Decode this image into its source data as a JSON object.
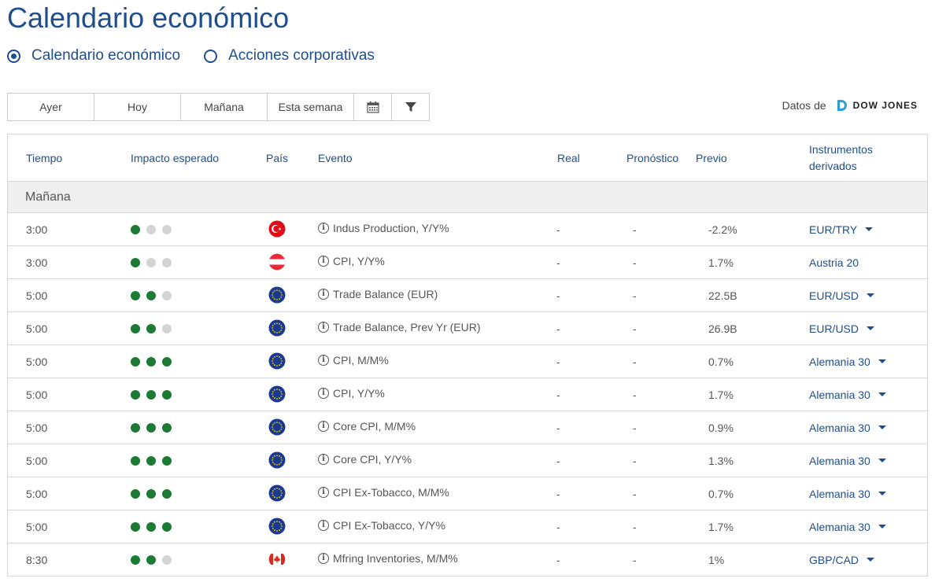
{
  "page": {
    "title": "Calendario económico"
  },
  "tabs": [
    {
      "label": "Calendario económico",
      "selected": true
    },
    {
      "label": "Acciones corporativas",
      "selected": false
    }
  ],
  "toolbar": {
    "buttons": [
      "Ayer",
      "Hoy",
      "Mañana",
      "Esta semana"
    ],
    "icons": [
      "calendar-icon",
      "filter-icon"
    ]
  },
  "source": {
    "prefix": "Datos de",
    "brand": "DOW JONES"
  },
  "table": {
    "headers": {
      "time": "Tiempo",
      "impact": "Impacto esperado",
      "country": "País",
      "event": "Evento",
      "real": "Real",
      "forecast": "Pronóstico",
      "previous": "Previo",
      "instruments_line1": "Instrumentos",
      "instruments_line2": "derivados"
    },
    "group": "Mañana",
    "rows": [
      {
        "time": "3:00",
        "impact": 1,
        "flag": "turkey-flag",
        "event": "Indus Production, Y/Y%",
        "real": "-",
        "forecast": "-",
        "previous": "-2.2%",
        "instrument": "EUR/TRY",
        "dropdown": true
      },
      {
        "time": "3:00",
        "impact": 1,
        "flag": "austria-flag",
        "event": "CPI, Y/Y%",
        "real": "-",
        "forecast": "-",
        "previous": "1.7%",
        "instrument": "Austria 20",
        "dropdown": false
      },
      {
        "time": "5:00",
        "impact": 2,
        "flag": "eu-flag",
        "event": "Trade Balance (EUR)",
        "real": "-",
        "forecast": "-",
        "previous": "22.5B",
        "instrument": "EUR/USD",
        "dropdown": true
      },
      {
        "time": "5:00",
        "impact": 2,
        "flag": "eu-flag",
        "event": "Trade Balance, Prev Yr (EUR)",
        "real": "-",
        "forecast": "-",
        "previous": "26.9B",
        "instrument": "EUR/USD",
        "dropdown": true
      },
      {
        "time": "5:00",
        "impact": 3,
        "flag": "eu-flag",
        "event": "CPI, M/M%",
        "real": "-",
        "forecast": "-",
        "previous": "0.7%",
        "instrument": "Alemania 30",
        "dropdown": true
      },
      {
        "time": "5:00",
        "impact": 3,
        "flag": "eu-flag",
        "event": "CPI, Y/Y%",
        "real": "-",
        "forecast": "-",
        "previous": "1.7%",
        "instrument": "Alemania 30",
        "dropdown": true
      },
      {
        "time": "5:00",
        "impact": 3,
        "flag": "eu-flag",
        "event": "Core CPI, M/M%",
        "real": "-",
        "forecast": "-",
        "previous": "0.9%",
        "instrument": "Alemania 30",
        "dropdown": true
      },
      {
        "time": "5:00",
        "impact": 3,
        "flag": "eu-flag",
        "event": "Core CPI, Y/Y%",
        "real": "-",
        "forecast": "-",
        "previous": "1.3%",
        "instrument": "Alemania 30",
        "dropdown": true
      },
      {
        "time": "5:00",
        "impact": 3,
        "flag": "eu-flag",
        "event": "CPI Ex-Tobacco, M/M%",
        "real": "-",
        "forecast": "-",
        "previous": "0.7%",
        "instrument": "Alemania 30",
        "dropdown": true
      },
      {
        "time": "5:00",
        "impact": 3,
        "flag": "eu-flag",
        "event": "CPI Ex-Tobacco, Y/Y%",
        "real": "-",
        "forecast": "-",
        "previous": "1.7%",
        "instrument": "Alemania 30",
        "dropdown": true
      },
      {
        "time": "8:30",
        "impact": 2,
        "flag": "canada-flag",
        "event": "Mfring Inventories, M/M%",
        "real": "-",
        "forecast": "-",
        "previous": "1%",
        "instrument": "GBP/CAD",
        "dropdown": true
      }
    ]
  },
  "colors": {
    "accent": "#1f4e8c",
    "impact_on": "#1c7a34",
    "impact_off": "#d4d4d4"
  }
}
